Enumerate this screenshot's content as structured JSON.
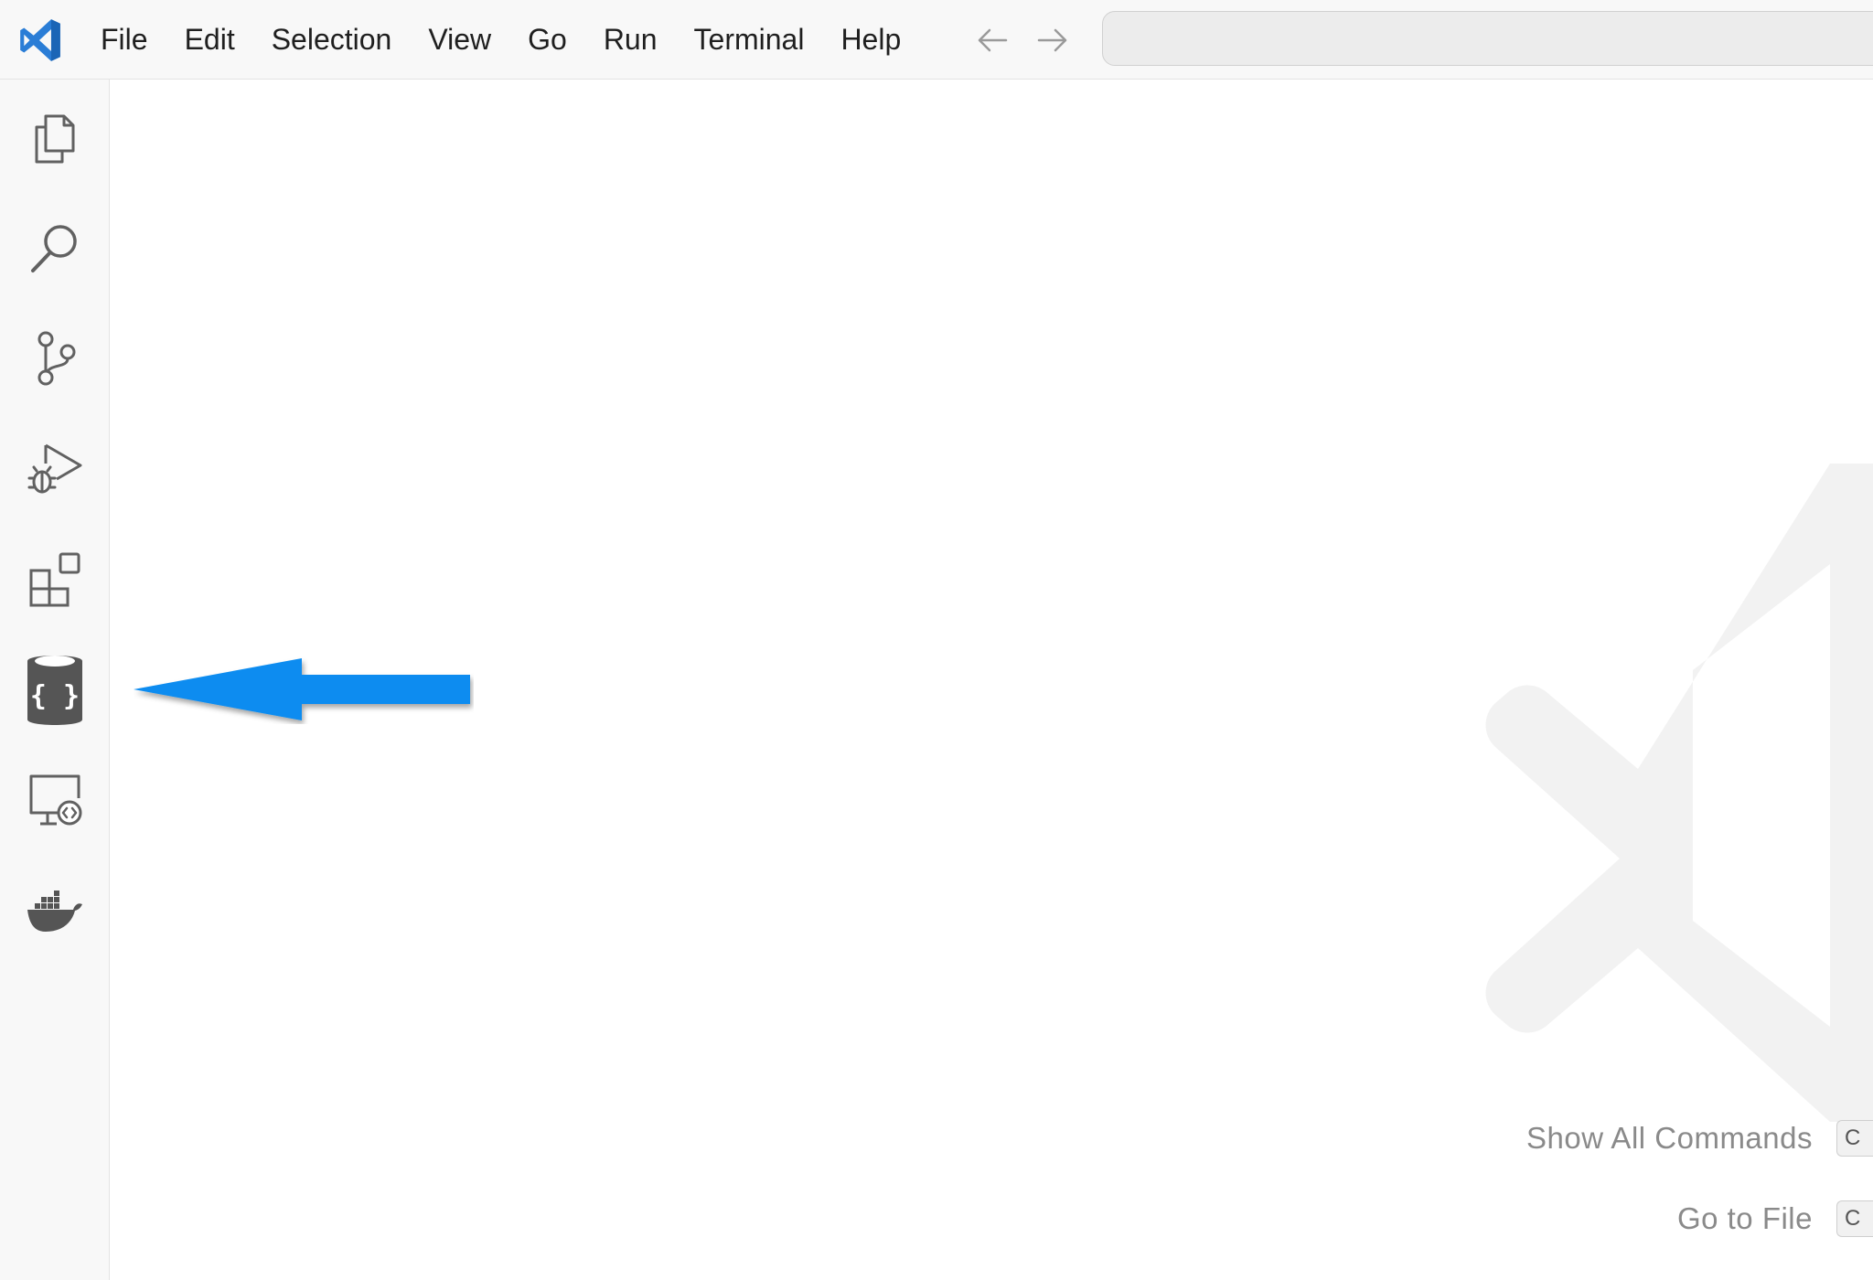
{
  "menu": {
    "items": [
      "File",
      "Edit",
      "Selection",
      "View",
      "Go",
      "Run",
      "Terminal",
      "Help"
    ]
  },
  "navigation": {
    "back_icon": "arrow-left-icon",
    "forward_icon": "arrow-right-icon"
  },
  "activity_bar": {
    "items": [
      {
        "name": "explorer",
        "icon": "files-icon"
      },
      {
        "name": "search",
        "icon": "search-icon"
      },
      {
        "name": "source-control",
        "icon": "source-control-icon"
      },
      {
        "name": "run-and-debug",
        "icon": "debug-icon"
      },
      {
        "name": "extensions",
        "icon": "extensions-icon"
      },
      {
        "name": "json-database",
        "icon": "json-database-icon"
      },
      {
        "name": "remote-explorer",
        "icon": "remote-explorer-icon"
      },
      {
        "name": "docker",
        "icon": "docker-icon"
      }
    ]
  },
  "editor": {
    "shortcuts": [
      {
        "label": "Show All Commands",
        "key": "C"
      },
      {
        "label": "Go to File",
        "key": "C"
      }
    ]
  },
  "colors": {
    "accent_blue": "#0a8cf0",
    "logo_blue": "#2a7dd6",
    "icon_gray": "#616161",
    "watermark": "#f2f2f2"
  }
}
